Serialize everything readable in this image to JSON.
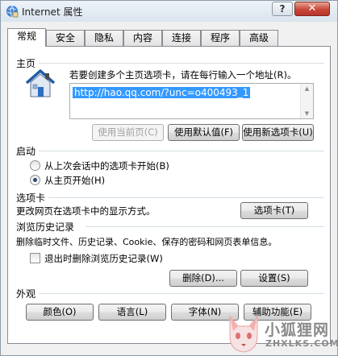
{
  "window": {
    "title": "Internet 属性",
    "help_label": "?",
    "close_label": "✕"
  },
  "tabs": [
    {
      "label": "常规",
      "active": true
    },
    {
      "label": "安全",
      "active": false
    },
    {
      "label": "隐私",
      "active": false
    },
    {
      "label": "内容",
      "active": false
    },
    {
      "label": "连接",
      "active": false
    },
    {
      "label": "程序",
      "active": false
    },
    {
      "label": "高级",
      "active": false
    }
  ],
  "home": {
    "group_label": "主页",
    "instruction": "若要创建多个主页选项卡，请在每行输入一个地址(R)。",
    "url_value": "http://hao.qq.com/?unc=o400493_1",
    "use_current_label": "使用当前页(C)",
    "use_default_label": "使用默认值(F)",
    "use_new_tab_label": "使用新选项卡(U)"
  },
  "startup": {
    "group_label": "启动",
    "option_last_session": "从上次会话中的选项卡开始(B)",
    "option_home_page": "从主页开始(H)",
    "selected": "home_page"
  },
  "tabs_section": {
    "group_label": "选项卡",
    "description": "更改网页在选项卡中的显示方式。",
    "button_label": "选项卡(T)"
  },
  "history": {
    "group_label": "浏览历史记录",
    "description": "删除临时文件、历史记录、Cookie、保存的密码和网页表单信息。",
    "delete_on_exit_label": "退出时删除浏览历史记录(W)",
    "delete_on_exit_checked": false,
    "delete_button": "删除(D)...",
    "settings_button": "设置(S)"
  },
  "appearance": {
    "group_label": "外观",
    "colors_button": "颜色(O)",
    "languages_button": "语言(L)",
    "fonts_button": "字体(N)",
    "accessibility_button": "辅助功能(E)"
  },
  "watermark": {
    "brand_cn": "小狐狸网",
    "brand_en": "ZHXLKS.COM"
  }
}
